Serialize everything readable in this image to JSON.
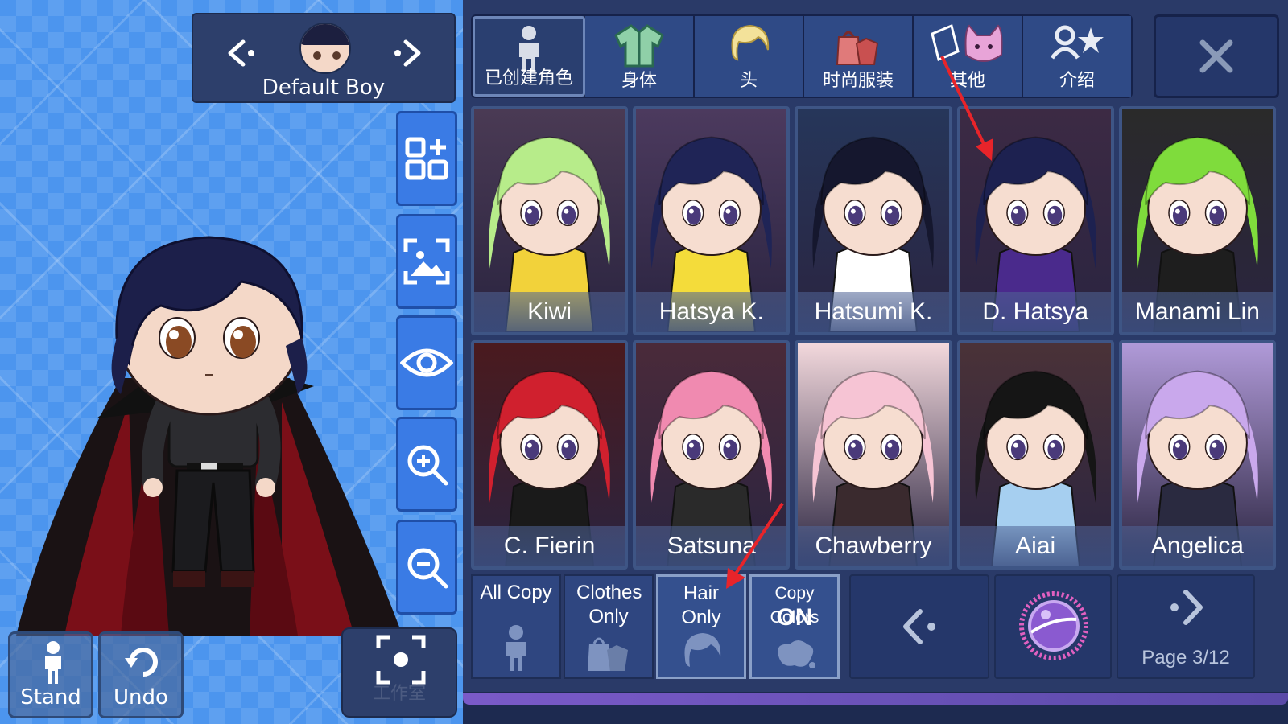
{
  "selector": {
    "name": "Default Boy"
  },
  "left_controls": {
    "stand_label": "Stand",
    "undo_label": "Undo",
    "watermark": "工作室"
  },
  "tabs": [
    {
      "label": "已创建角色",
      "icon": "person-icon",
      "active": true
    },
    {
      "label": "身体",
      "icon": "jacket-icon",
      "active": false
    },
    {
      "label": "头",
      "icon": "hair-icon",
      "active": false
    },
    {
      "label": "时尚服装",
      "icon": "clothes-bag-icon",
      "active": false
    },
    {
      "label": "其他",
      "icon": "cat-icon",
      "active": false
    },
    {
      "label": "介绍",
      "icon": "profile-star-icon",
      "active": false
    }
  ],
  "presets": [
    {
      "name": "Kiwi",
      "hair": "#b7ec8a",
      "bg": "#4a3a54",
      "outfit": "#f2d23a"
    },
    {
      "name": "Hatsya K.",
      "hair": "#1f2456",
      "bg": "#4c3a5e",
      "outfit": "#f4dc3a"
    },
    {
      "name": "Hatsumi K.",
      "hair": "#15172e",
      "bg": "#26365a",
      "outfit": "#ffffff"
    },
    {
      "name": "D. Hatsya",
      "hair": "#1d2150",
      "bg": "#3c2a44",
      "outfit": "#4a2a8c"
    },
    {
      "name": "Manami Lin",
      "hair": "#7fdc3c",
      "bg": "#2a2a2a",
      "outfit": "#1e1e1e"
    },
    {
      "name": "C. Fierin",
      "hair": "#d0202e",
      "bg": "#4a1a1e",
      "outfit": "#1a1a1a"
    },
    {
      "name": "Satsuna",
      "hair": "#f08ab0",
      "bg": "#4a2a3a",
      "outfit": "#2a2a2a"
    },
    {
      "name": "Chawberry",
      "hair": "#f6c4d4",
      "bg": "#f2d8dc",
      "outfit": "#3a2a2e"
    },
    {
      "name": "Aiai",
      "hair": "#151515",
      "bg": "#4a3238",
      "outfit": "#a6cff0"
    },
    {
      "name": "Angelica",
      "hair": "#c9a8ec",
      "bg": "#b09ad8",
      "outfit": "#2a2a40"
    }
  ],
  "copy_options": {
    "all_copy": "All Copy",
    "clothes_only": "Clothes Only",
    "hair_only": "Hair Only",
    "copy_colors": "Copy Colors",
    "copy_colors_state": "ON"
  },
  "pagination": {
    "page_label": "Page 3/12",
    "current": 3,
    "total": 12
  },
  "colors": {
    "panel": "#2a3a68",
    "stage": "#4c95ee",
    "annotation_arrow": "#e8242a"
  }
}
